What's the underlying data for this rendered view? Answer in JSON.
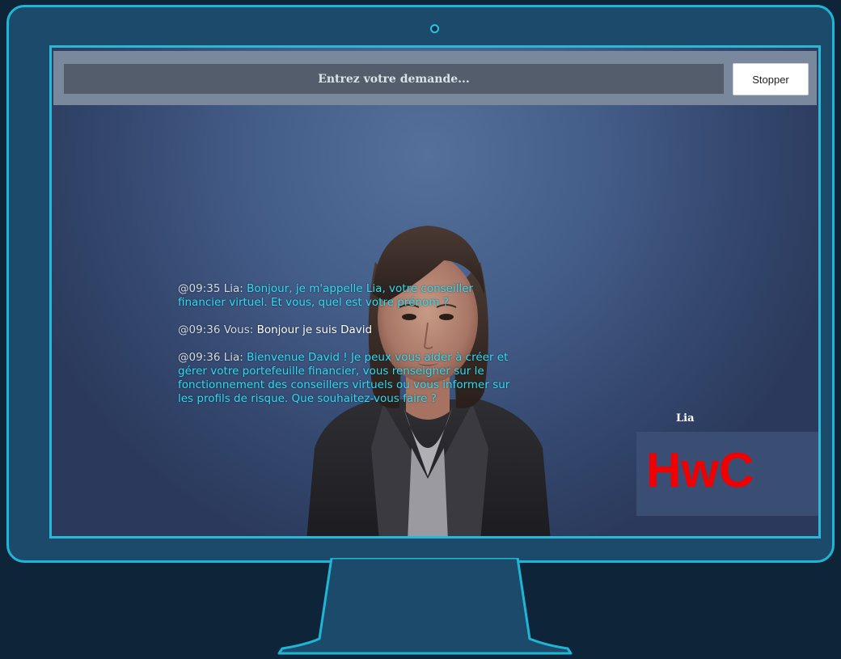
{
  "header": {
    "input_value": "",
    "input_placeholder": "Entrez votre demande...",
    "stop_label": "Stopper"
  },
  "chat": {
    "messages": [
      {
        "time": "@09:35",
        "speaker": "Lia:",
        "text": "Bonjour, je m'appelle Lia, votre conseiller financier virtuel. Et vous, quel est votre prénom ?",
        "from": "agent"
      },
      {
        "time": "@09:36",
        "speaker": "Vous:",
        "text": "Bonjour je suis David",
        "from": "user"
      },
      {
        "time": "@09:36",
        "speaker": "Lia:",
        "text": "Bienvenue David ! Je peux vous aider à créer et gérer votre portefeuille financier, vous renseigner sur le fonctionnement des conseillers virtuels ou vous informer sur les profils de risque. Que souhaitez-vous faire ?",
        "from": "agent"
      }
    ]
  },
  "agent": {
    "name": "Lia"
  },
  "brand": {
    "text": "HwC",
    "color": "#f00000"
  },
  "colors": {
    "frame_accent": "#1fb6d6",
    "agent_text": "#2fdcf4",
    "user_text": "#ffffff",
    "background": "#0e2438"
  },
  "icons": {
    "camera": "webcam-dot-icon"
  }
}
